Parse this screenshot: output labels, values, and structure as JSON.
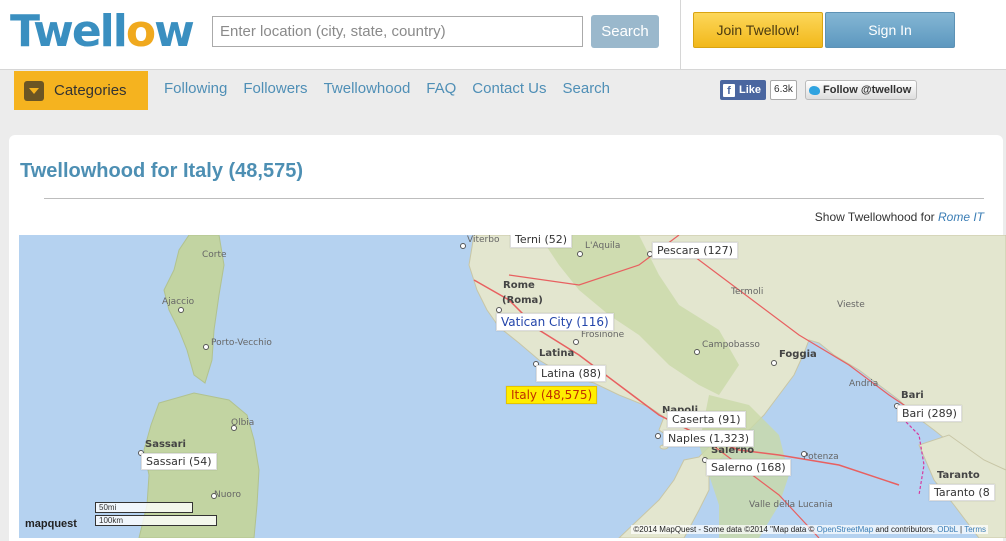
{
  "header": {
    "logo_text": "Twellow",
    "search_placeholder": "Enter location (city, state, country)",
    "search_button": "Search",
    "join_button": "Join Twellow!",
    "signin_button": "Sign In"
  },
  "nav": {
    "categories_label": "Categories",
    "links": [
      "Following",
      "Followers",
      "Twellowhood",
      "FAQ",
      "Contact Us",
      "Search"
    ],
    "fb_like": "Like",
    "fb_count": "6.3k",
    "twitter_follow": "Follow @twellow"
  },
  "page": {
    "title": "Twellowhood for Italy (48,575)",
    "show_for_prefix": "Show Twellowhood for",
    "show_for_link": "Rome IT"
  },
  "map": {
    "markers": [
      {
        "label": "Terni (52)"
      },
      {
        "label": "Pescara (127)"
      },
      {
        "label": "Vatican City (116)"
      },
      {
        "label": "Latina (88)"
      },
      {
        "label": "Italy (48,575)"
      },
      {
        "label": "Caserta (91)"
      },
      {
        "label": "Naples (1,323)"
      },
      {
        "label": "Salerno (168)"
      },
      {
        "label": "Sassari (54)"
      },
      {
        "label": "Bari (289)"
      },
      {
        "label": "Taranto (8"
      }
    ],
    "place_names": [
      "Viterbo",
      "L'Aquila",
      "Rome",
      "(Roma)",
      "Termoli",
      "Vieste",
      "Frosinone",
      "Latina",
      "Campobasso",
      "Foggia",
      "Andria",
      "Bari",
      "Napoli",
      "Salerno",
      "Potenza",
      "Taranto",
      "Corte",
      "Ajaccio",
      "Porto-Vecchio",
      "Olbia",
      "Sassari",
      "Nuoro",
      "Valle della Lucania"
    ],
    "branding": "mapquest",
    "scale_mi": "50mi",
    "scale_km": "100km",
    "attribution": "©2014 MapQuest  -  Some data ©2014 \"Map data ©",
    "osm_link": "OpenStreetMap",
    "attribution_tail": "and contributors,",
    "odbl_link": "ODbL",
    "terms_link": "Terms"
  }
}
